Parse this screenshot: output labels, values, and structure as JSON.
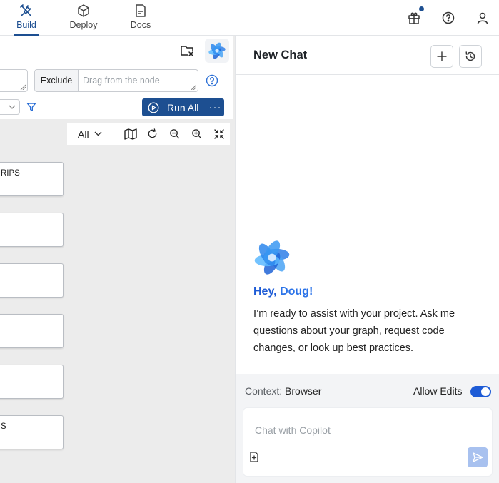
{
  "nav": {
    "tabs": [
      {
        "label": "Build",
        "icon": "build-icon",
        "active": true
      },
      {
        "label": "Deploy",
        "icon": "cube-icon",
        "active": false
      },
      {
        "label": "Docs",
        "icon": "document-icon",
        "active": false
      }
    ],
    "right_icons": [
      "gift-icon",
      "help-icon",
      "user-icon"
    ],
    "accent": "#1d4f91"
  },
  "workspace": {
    "exclude_label": "Exclude",
    "exclude_placeholder": "Drag from the node",
    "run_all_label": "Run All",
    "run_more_label": "···",
    "graph_filter_value": "All",
    "nodes": [
      {
        "label": "RIPS"
      },
      {
        "label": ""
      },
      {
        "label": ""
      },
      {
        "label": ""
      },
      {
        "label": ""
      },
      {
        "label": "S"
      }
    ]
  },
  "chat": {
    "title": "New Chat",
    "greeting_prefix": "Hey, ",
    "greeting_name": "Doug!",
    "intro": "I’m ready to assist with your project. Ask me questions about your graph, request code changes, or look up best practices.",
    "context_label": "Context:",
    "context_value": "Browser",
    "allow_edits_label": "Allow Edits",
    "allow_edits_on": true,
    "input_placeholder": "Chat with Copilot"
  }
}
